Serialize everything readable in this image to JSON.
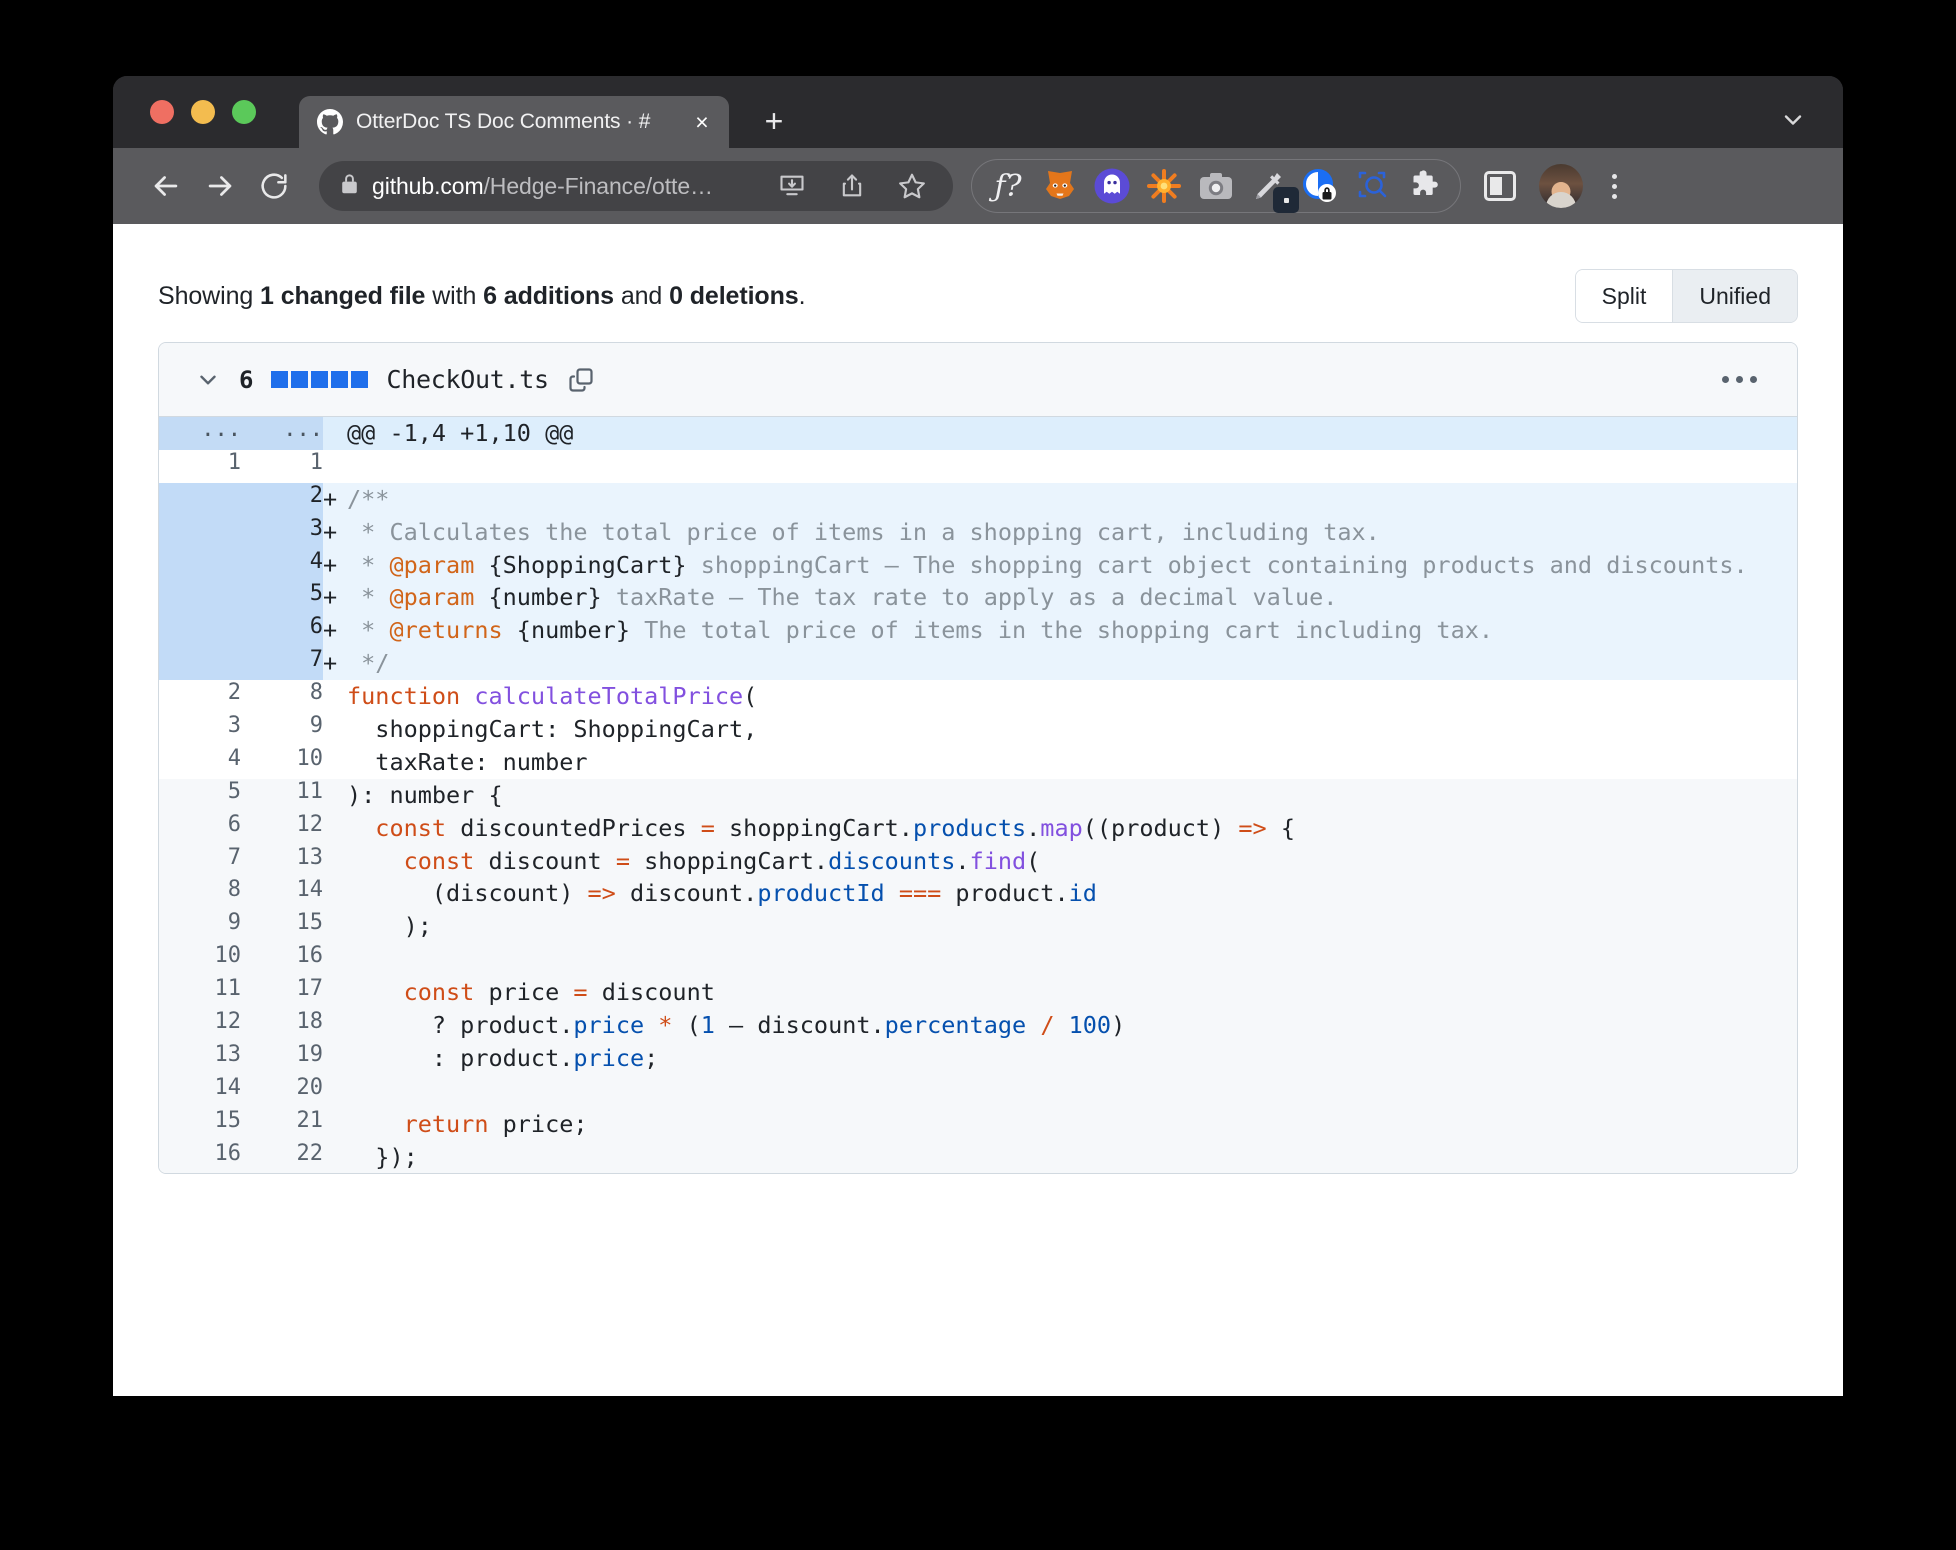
{
  "browser": {
    "tab": {
      "title": "OtterDoc TS Doc Comments · #",
      "favicon": "github-icon",
      "close": "×"
    },
    "new_tab_label": "+",
    "url": {
      "host": "github.com",
      "path": "/Hedge-Finance/otte…"
    },
    "toolbar_icons": [
      "back-icon",
      "forward-icon",
      "reload-icon",
      "lock-icon",
      "install-icon",
      "share-icon",
      "bookmark-star-icon"
    ],
    "extensions": [
      {
        "name": "formula-extension-icon",
        "glyph": "ƒ?"
      },
      {
        "name": "metamask-extension-icon",
        "glyph": "🦊"
      },
      {
        "name": "ghost-extension-icon",
        "glyph": "👻"
      },
      {
        "name": "starburst-extension-icon",
        "glyph": "✳"
      },
      {
        "name": "screenshot-extension-icon",
        "glyph": "📷"
      },
      {
        "name": "eyedropper-extension-icon",
        "glyph": "🖌"
      },
      {
        "name": "privacy-lock-extension-icon",
        "glyph": "🔒"
      },
      {
        "name": "inspect-extension-icon",
        "glyph": "🔍"
      },
      {
        "name": "puzzle-extensions-icon",
        "glyph": "🧩"
      }
    ],
    "sidebar_toggle": "sidebar-toggle-icon",
    "profile": "profile-avatar",
    "menu": "browser-menu-icon"
  },
  "page": {
    "showing": {
      "prefix": "Showing ",
      "changed_files": "1 changed file",
      "mid": " with ",
      "additions": "6 additions",
      "conj": " and ",
      "deletions": "0 deletions",
      "suffix": "."
    },
    "view_toggle": {
      "split": "Split",
      "unified": "Unified",
      "selected": "Unified"
    },
    "file": {
      "change_count": "6",
      "diffstat_squares": 5,
      "diffstat_color": "#1f6feb",
      "name": "CheckOut.ts",
      "copy_label": "copy-path-icon",
      "menu_label": "file-options-menu"
    },
    "hunk_header": "@@ -1,4 +1,10 @@",
    "rows": [
      {
        "type": "hunk",
        "old": "...",
        "new": "...",
        "mark": "",
        "tokens": [
          [
            "pl",
            "@@ -1,4 +1,10 @@"
          ]
        ]
      },
      {
        "type": "ctx",
        "old": "1",
        "new": "1",
        "mark": "",
        "tokens": []
      },
      {
        "type": "add",
        "old": "",
        "new": "2",
        "mark": "+",
        "tokens": [
          [
            "cm",
            "/**"
          ]
        ]
      },
      {
        "type": "add",
        "old": "",
        "new": "3",
        "mark": "+",
        "tokens": [
          [
            "cm",
            " * Calculates the total price of items in a shopping cart, including tax."
          ]
        ]
      },
      {
        "type": "add",
        "old": "",
        "new": "4",
        "mark": "+",
        "tokens": [
          [
            "cm",
            " * "
          ],
          [
            "tag",
            "@param"
          ],
          [
            "cm",
            " "
          ],
          [
            "ty",
            "{ShoppingCart}"
          ],
          [
            "cm",
            " shoppingCart — The shopping cart object containing products and discounts."
          ]
        ]
      },
      {
        "type": "add",
        "old": "",
        "new": "5",
        "mark": "+",
        "tokens": [
          [
            "cm",
            " * "
          ],
          [
            "tag",
            "@param"
          ],
          [
            "cm",
            " "
          ],
          [
            "ty",
            "{number}"
          ],
          [
            "cm",
            " taxRate — The tax rate to apply as a decimal value."
          ]
        ]
      },
      {
        "type": "add",
        "old": "",
        "new": "6",
        "mark": "+",
        "tokens": [
          [
            "cm",
            " * "
          ],
          [
            "tag",
            "@returns"
          ],
          [
            "cm",
            " "
          ],
          [
            "ty",
            "{number}"
          ],
          [
            "cm",
            " The total price of items in the shopping cart including tax."
          ]
        ]
      },
      {
        "type": "add",
        "old": "",
        "new": "7",
        "mark": "+",
        "tokens": [
          [
            "cm",
            " */"
          ]
        ]
      },
      {
        "type": "ctx",
        "old": "2",
        "new": "8",
        "mark": "",
        "tokens": [
          [
            "k",
            "function"
          ],
          [
            "pl",
            " "
          ],
          [
            "fn",
            "calculateTotalPrice"
          ],
          [
            "pl",
            "("
          ]
        ]
      },
      {
        "type": "ctx",
        "old": "3",
        "new": "9",
        "mark": "",
        "tokens": [
          [
            "pl",
            "  shoppingCart: ShoppingCart,"
          ]
        ]
      },
      {
        "type": "ctx",
        "old": "4",
        "new": "10",
        "mark": "",
        "tokens": [
          [
            "pl",
            "  taxRate: number"
          ]
        ]
      },
      {
        "type": "plain",
        "old": "5",
        "new": "11",
        "mark": "",
        "tokens": [
          [
            "pl",
            "): number {"
          ]
        ]
      },
      {
        "type": "plain",
        "old": "6",
        "new": "12",
        "mark": "",
        "tokens": [
          [
            "pl",
            "  "
          ],
          [
            "k",
            "const"
          ],
          [
            "pl",
            " discountedPrices "
          ],
          [
            "op",
            "="
          ],
          [
            "pl",
            " shoppingCart."
          ],
          [
            "pr",
            "products"
          ],
          [
            "pl",
            "."
          ],
          [
            "fn",
            "map"
          ],
          [
            "pl",
            "((product) "
          ],
          [
            "op",
            "=>"
          ],
          [
            "pl",
            " {"
          ]
        ]
      },
      {
        "type": "plain",
        "old": "7",
        "new": "13",
        "mark": "",
        "tokens": [
          [
            "pl",
            "    "
          ],
          [
            "k",
            "const"
          ],
          [
            "pl",
            " discount "
          ],
          [
            "op",
            "="
          ],
          [
            "pl",
            " shoppingCart."
          ],
          [
            "pr",
            "discounts"
          ],
          [
            "pl",
            "."
          ],
          [
            "fn",
            "find"
          ],
          [
            "pl",
            "("
          ]
        ]
      },
      {
        "type": "plain",
        "old": "8",
        "new": "14",
        "mark": "",
        "tokens": [
          [
            "pl",
            "      (discount) "
          ],
          [
            "op",
            "=>"
          ],
          [
            "pl",
            " discount."
          ],
          [
            "pr",
            "productId"
          ],
          [
            "pl",
            " "
          ],
          [
            "op",
            "==="
          ],
          [
            "pl",
            " product."
          ],
          [
            "pr",
            "id"
          ]
        ]
      },
      {
        "type": "plain",
        "old": "9",
        "new": "15",
        "mark": "",
        "tokens": [
          [
            "pl",
            "    );"
          ]
        ]
      },
      {
        "type": "plain",
        "old": "10",
        "new": "16",
        "mark": "",
        "tokens": []
      },
      {
        "type": "plain",
        "old": "11",
        "new": "17",
        "mark": "",
        "tokens": [
          [
            "pl",
            "    "
          ],
          [
            "k",
            "const"
          ],
          [
            "pl",
            " price "
          ],
          [
            "op",
            "="
          ],
          [
            "pl",
            " discount"
          ]
        ]
      },
      {
        "type": "plain",
        "old": "12",
        "new": "18",
        "mark": "",
        "tokens": [
          [
            "pl",
            "      ? product."
          ],
          [
            "pr",
            "price"
          ],
          [
            "pl",
            " "
          ],
          [
            "op",
            "*"
          ],
          [
            "pl",
            " ("
          ],
          [
            "nm",
            "1"
          ],
          [
            "pl",
            " — discount."
          ],
          [
            "pr",
            "percentage"
          ],
          [
            "pl",
            " "
          ],
          [
            "op",
            "/"
          ],
          [
            "pl",
            " "
          ],
          [
            "nm",
            "100"
          ],
          [
            "pl",
            ")"
          ]
        ]
      },
      {
        "type": "plain",
        "old": "13",
        "new": "19",
        "mark": "",
        "tokens": [
          [
            "pl",
            "      : product."
          ],
          [
            "pr",
            "price"
          ],
          [
            "pl",
            ";"
          ]
        ]
      },
      {
        "type": "plain",
        "old": "14",
        "new": "20",
        "mark": "",
        "tokens": []
      },
      {
        "type": "plain",
        "old": "15",
        "new": "21",
        "mark": "",
        "tokens": [
          [
            "pl",
            "    "
          ],
          [
            "k",
            "return"
          ],
          [
            "pl",
            " price;"
          ]
        ]
      },
      {
        "type": "plain",
        "old": "16",
        "new": "22",
        "mark": "",
        "tokens": [
          [
            "pl",
            "  });"
          ]
        ]
      }
    ]
  }
}
